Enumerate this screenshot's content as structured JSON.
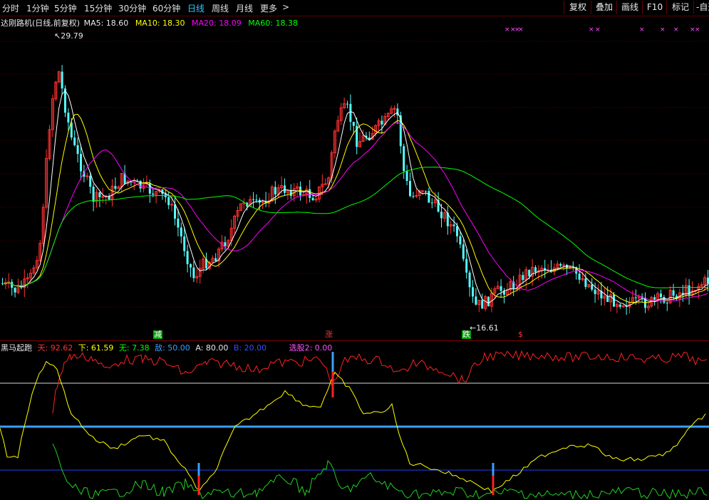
{
  "toolbar": {
    "tabs": [
      "分时",
      "1分钟",
      "5分钟",
      "15分钟",
      "30分钟",
      "60分钟",
      "日线",
      "周线",
      "月线",
      "更多"
    ],
    "more_arrow": ">",
    "active_tab": "日线",
    "right_buttons": [
      "复权",
      "叠加",
      "画线",
      "F10",
      "标记",
      "-自选"
    ]
  },
  "main_chart": {
    "title": "达刚路机(日线,前复权)",
    "ma5_label": "MA5: 18.60",
    "ma10_label": "MA10: 18.30",
    "ma20_label": "MA20: 18.09",
    "ma60_label": "MA60: 18.38",
    "high_label": "29.79",
    "low_label": "16.61",
    "markers": [
      "减",
      "涨",
      "跌",
      "$"
    ],
    "colors": {
      "ma5": "#ffffff",
      "ma10": "#ffff00",
      "ma20": "#ff00ff",
      "ma60": "#00ff00",
      "up": "#ff3232",
      "down": "#54ffff"
    }
  },
  "indicator": {
    "name": "黑马起跑",
    "tian": "天: 92.62",
    "xia": "下: 61.59",
    "wu": "无: 7.38",
    "di": "敌: 50.00",
    "a": "A: 80.00",
    "b": "B: 20.00",
    "xuangu": "选股2: 0.00"
  }
}
